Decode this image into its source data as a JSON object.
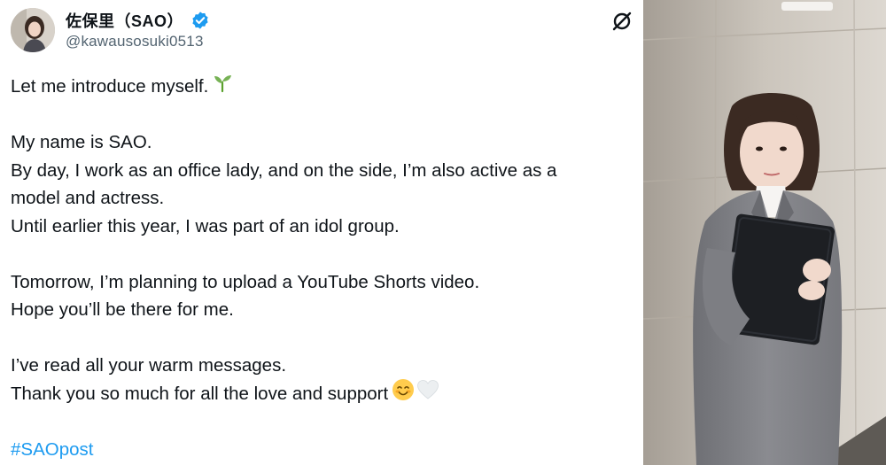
{
  "post": {
    "display_name": "佐保里（SAO）",
    "handle": "@kawausosuki0513",
    "lines": [
      "Let me introduce myself.",
      "My name is SAO.",
      "By day, I work as an office lady, and on the side, I’m also active as a",
      "model and actress.",
      "Until earlier this year, I was part of an idol group.",
      "Tomorrow, I’m planning to upload a YouTube Shorts video.",
      "Hope you’ll be there for me.",
      "I’ve read all your warm messages.",
      "Thank you so much for all the love and support",
      "#SAOpost"
    ],
    "icons": {
      "verified": "verified-badge-icon",
      "logo": "x-logo-icon",
      "seedling": "seedling-emoji",
      "smile": "smiling-face-emoji",
      "heart": "white-heart-emoji"
    },
    "colors": {
      "hashtag": "#1d9bf0",
      "verified": "#1d9bf0",
      "handle": "#536471"
    }
  }
}
